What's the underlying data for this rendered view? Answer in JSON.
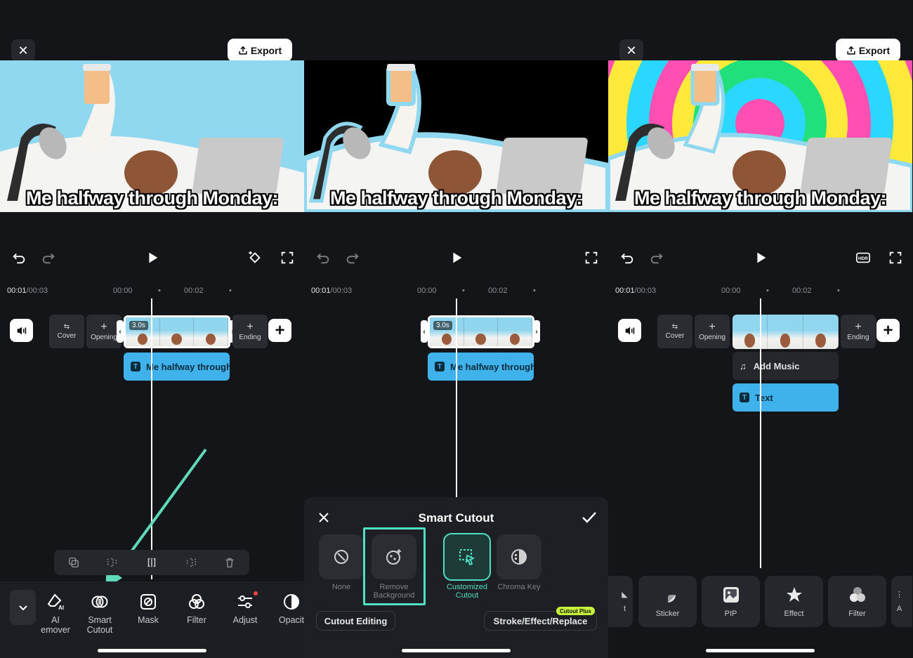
{
  "colors": {
    "accent_teal": "#4fe0c3",
    "text_track_blue": "#3fb2ec",
    "badge_green": "#c6f23a",
    "notif_red": "#f0453d"
  },
  "caption": "Me halfway through Monday:",
  "panel1": {
    "export_label": "Export",
    "timecode_current": "00:01",
    "timecode_total": "/00:03",
    "tick_1": "00:00",
    "tick_2": "00:02",
    "cover_label": "Cover",
    "opening_label": "Opening",
    "ending_label": "Ending",
    "clip_duration": "3.0s",
    "text_track_label": "Me halfway through",
    "tools": [
      {
        "label": "AI\nRemover",
        "icon": "eraser-ai-icon"
      },
      {
        "label": "Smart\nCutout",
        "icon": "smart-cutout-icon"
      },
      {
        "label": "Mask",
        "icon": "mask-icon"
      },
      {
        "label": "Filter",
        "icon": "filter-icon"
      },
      {
        "label": "Adjust",
        "icon": "adjust-icon"
      },
      {
        "label": "Opacit",
        "icon": "opacity-icon"
      }
    ],
    "tool_labels": {
      "ai_remover_1": "AI",
      "ai_remover_2": "emover",
      "smart_1": "Smart",
      "smart_2": "Cutout",
      "mask": "Mask",
      "filter": "Filter",
      "adjust": "Adjust",
      "opacity": "Opacit"
    }
  },
  "panel2": {
    "timecode_current": "00:01",
    "timecode_total": "/00:03",
    "tick_1": "00:00",
    "tick_2": "00:02",
    "clip_duration": "3.0s",
    "text_track_label": "Me halfway through",
    "sheet_title": "Smart Cutout",
    "options": {
      "none": "None",
      "remove_bg_1": "Remove",
      "remove_bg_2": "Background",
      "custom_1": "Customized",
      "custom_2": "Cutout",
      "chroma": "Chroma Key"
    },
    "cutout_editing_label": "Cutout Editing",
    "stroke_label": "Stroke/Effect/Replace",
    "badge_label": "Cutout Plus"
  },
  "panel3": {
    "export_label": "Export",
    "timecode_current": "00:01",
    "timecode_total": "/00:03",
    "tick_1": "00:00",
    "tick_2": "00:02",
    "cover_label": "Cover",
    "opening_label": "Opening",
    "ending_label": "Ending",
    "music_label": "Add Music",
    "text_label": "Text",
    "tiles": {
      "partial": "t",
      "sticker": "Sticker",
      "pip": "PIP",
      "effect": "Effect",
      "filter": "Filter",
      "partial_right": "A"
    }
  }
}
